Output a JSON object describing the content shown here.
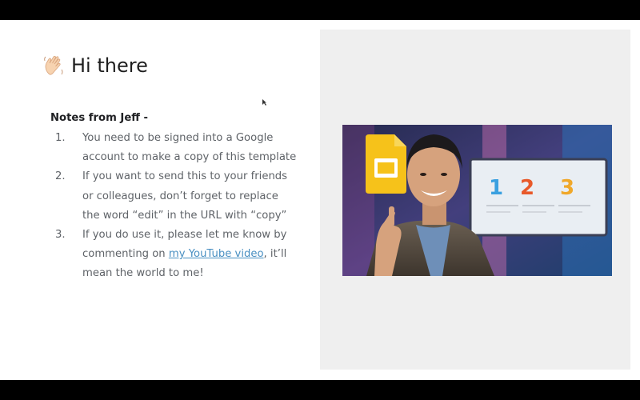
{
  "slide": {
    "title": "Hi there",
    "title_icon": "waving-hand-icon",
    "notes_heading": "Notes from Jeff -",
    "items": [
      {
        "num": "1.",
        "text": "You need to be signed into a Google account to make a copy of this template"
      },
      {
        "num": "2.",
        "text": "If you want to send this to your friends or colleagues, don’t forget to replace the word “edit” in the URL with “copy”"
      },
      {
        "num": "3.",
        "text_before": "If you do use it, please let me know by commenting on ",
        "link": "my YouTube video",
        "text_after": ", it’ll mean the world to me!"
      }
    ]
  },
  "thumbnail": {
    "icon": "google-slides-icon",
    "screen_numbers": [
      "1",
      "2",
      "3"
    ],
    "colors": {
      "num1": "#3aa0e0",
      "num2": "#e8592a",
      "num3": "#f0a82a",
      "slides_yellow": "#f6c21a"
    }
  }
}
